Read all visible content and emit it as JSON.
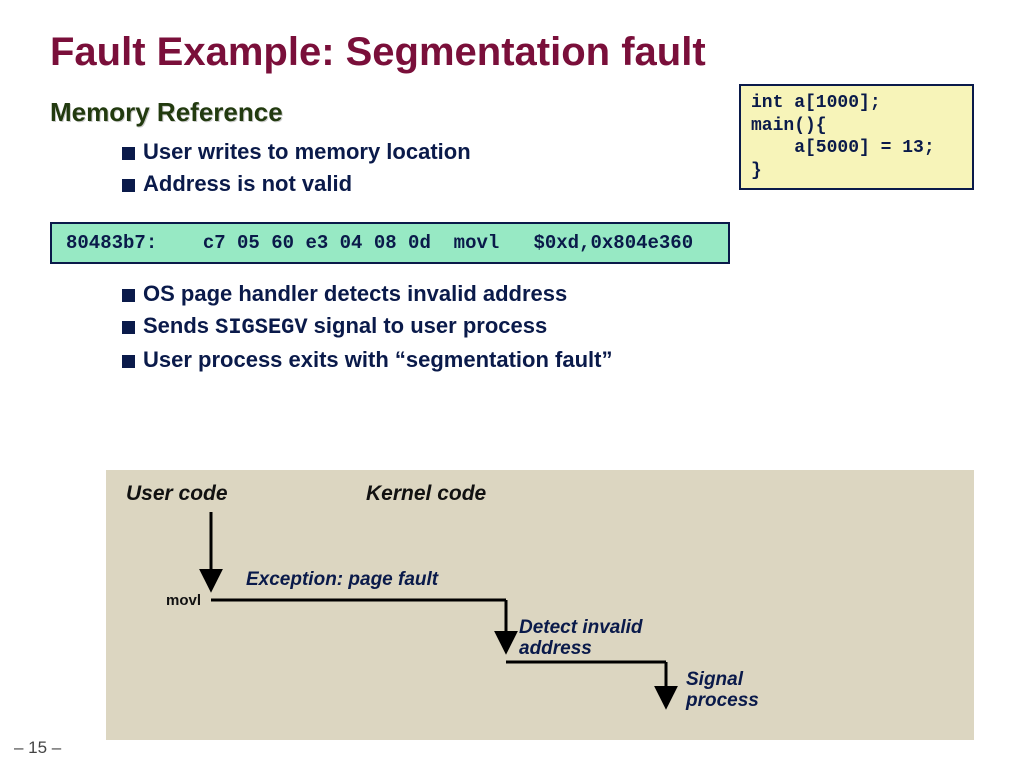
{
  "title": "Fault Example: Segmentation fault",
  "subtitle": "Memory Reference",
  "top_bullets": [
    "User writes to memory location",
    "Address is not valid"
  ],
  "code_box": "int a[1000];\nmain(){\n    a[5000] = 13;\n}",
  "asm_line": "80483b7:    c7 05 60 e3 04 08 0d  movl   $0xd,0x804e360",
  "bottom_bullets": [
    "OS page handler detects invalid address",
    {
      "pre": "Sends ",
      "code": "SIGSEGV",
      "post": " signal to user process"
    },
    "User process exits with “segmentation fault”"
  ],
  "diagram": {
    "user_header": "User code",
    "kernel_header": "Kernel code",
    "step_movl": "movl",
    "event_pagefault": "Exception: page fault",
    "event_detect": "Detect invalid\naddress",
    "event_signal": "Signal\nprocess"
  },
  "page_number": "– 15 –"
}
